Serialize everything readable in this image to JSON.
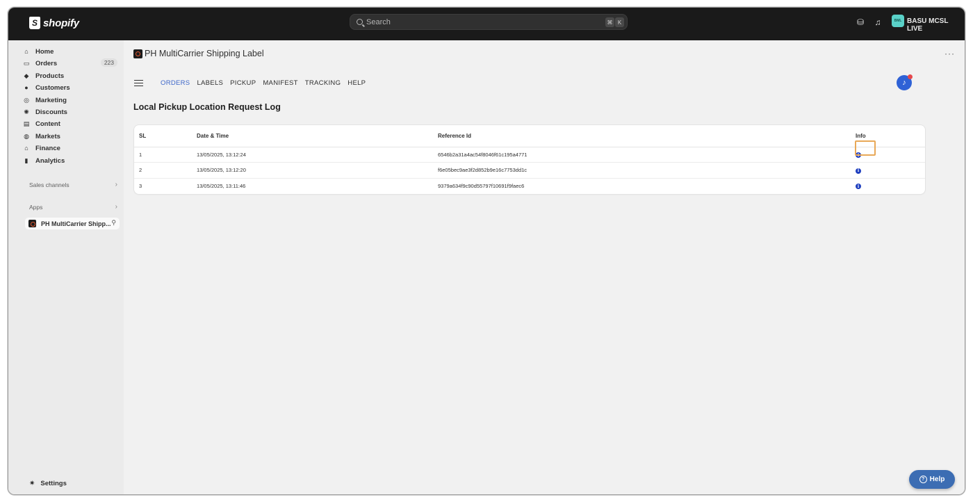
{
  "topbar": {
    "brand": "shopify",
    "search_placeholder": "Search",
    "shortcut_keys": [
      "⌘",
      "K"
    ],
    "store_initials": "BML",
    "store_name": "BASU MCSL LIVE"
  },
  "sidebar": {
    "items": [
      {
        "label": "Home",
        "icon": "home-icon",
        "glyph": "⌂"
      },
      {
        "label": "Orders",
        "icon": "orders-icon",
        "glyph": "▭",
        "badge": "223"
      },
      {
        "label": "Products",
        "icon": "tag-icon",
        "glyph": "◆"
      },
      {
        "label": "Customers",
        "icon": "person-icon",
        "glyph": "●"
      },
      {
        "label": "Marketing",
        "icon": "target-icon",
        "glyph": "◎"
      },
      {
        "label": "Discounts",
        "icon": "discount-icon",
        "glyph": "✺"
      },
      {
        "label": "Content",
        "icon": "content-icon",
        "glyph": "▤"
      },
      {
        "label": "Markets",
        "icon": "globe-icon",
        "glyph": "◍"
      },
      {
        "label": "Finance",
        "icon": "bank-icon",
        "glyph": "⌂"
      },
      {
        "label": "Analytics",
        "icon": "bar-chart-icon",
        "glyph": "▮"
      }
    ],
    "sales_channels_label": "Sales channels",
    "apps_label": "Apps",
    "app_item_label": "PH MultiCarrier Shipp...",
    "settings_label": "Settings"
  },
  "main": {
    "app_title": "PH MultiCarrier Shipping Label",
    "more_label": "···",
    "tabs": [
      {
        "label": "ORDERS",
        "active": true
      },
      {
        "label": "LABELS",
        "active": false
      },
      {
        "label": "PICKUP",
        "active": false
      },
      {
        "label": "MANIFEST",
        "active": false
      },
      {
        "label": "TRACKING",
        "active": false
      },
      {
        "label": "HELP",
        "active": false
      }
    ],
    "page_title": "Local Pickup Location Request Log",
    "table": {
      "columns": [
        "SL",
        "Date & Time",
        "Reference Id",
        "Info"
      ],
      "rows": [
        {
          "sl": "1",
          "datetime": "13/05/2025, 13:12:24",
          "reference": "6546b2a31a4ac54f8046f61c195a4771"
        },
        {
          "sl": "2",
          "datetime": "13/05/2025, 13:12:20",
          "reference": "f6e05bec9ae3f2d852b9e16c7753dd1c"
        },
        {
          "sl": "3",
          "datetime": "13/05/2025, 13:11:46",
          "reference": "9379a634f9c90d55797f10691f9faec6"
        }
      ]
    },
    "help_button_label": "Help"
  },
  "colors": {
    "accent": "#3e67c9",
    "topbar": "#1a1a1a",
    "help_button": "#3c6db3",
    "highlight": "#e8a857"
  }
}
